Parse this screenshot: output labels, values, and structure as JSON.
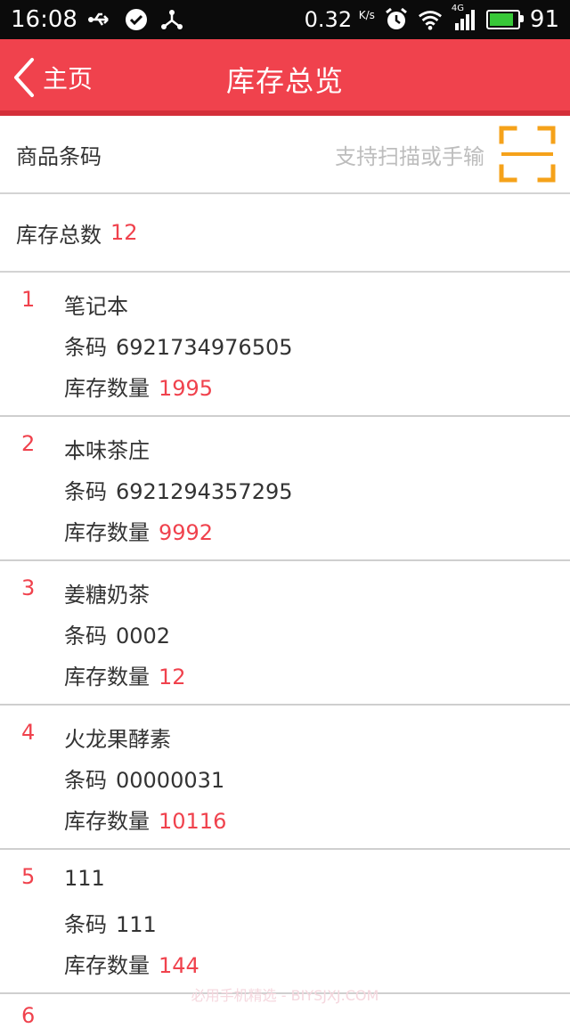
{
  "status": {
    "time": "16:08",
    "net_speed": "0.32",
    "net_unit": "K/s",
    "network_type": "4G",
    "battery": "91",
    "icons": [
      "usb-icon",
      "check-circle-icon",
      "share-icon",
      "alarm-icon",
      "wifi-icon",
      "signal-icon",
      "battery-icon"
    ]
  },
  "header": {
    "back_label": "主页",
    "title": "库存总览"
  },
  "barcode_input": {
    "label": "商品条码",
    "placeholder": "支持扫描或手输"
  },
  "total": {
    "label": "库存总数",
    "value": "12"
  },
  "labels": {
    "barcode": "条码",
    "stock": "库存数量"
  },
  "items": [
    {
      "index": "1",
      "name": "笔记本",
      "barcode": "6921734976505",
      "stock": "1995"
    },
    {
      "index": "2",
      "name": "本味茶庄",
      "barcode": "6921294357295",
      "stock": "9992"
    },
    {
      "index": "3",
      "name": "姜糖奶茶",
      "barcode": "0002",
      "stock": "12"
    },
    {
      "index": "4",
      "name": "火龙果酵素",
      "barcode": "00000031",
      "stock": "10116"
    },
    {
      "index": "5",
      "name": "111",
      "barcode": "111",
      "stock": "144"
    }
  ],
  "partial_next_index": "6",
  "watermark": "必用手机精选 - BIYSJXJ.COM",
  "colors": {
    "accent": "#f0424d",
    "header_border": "#d42f3a",
    "scan_icon": "#f5a21a",
    "placeholder": "#bdbdbd"
  }
}
